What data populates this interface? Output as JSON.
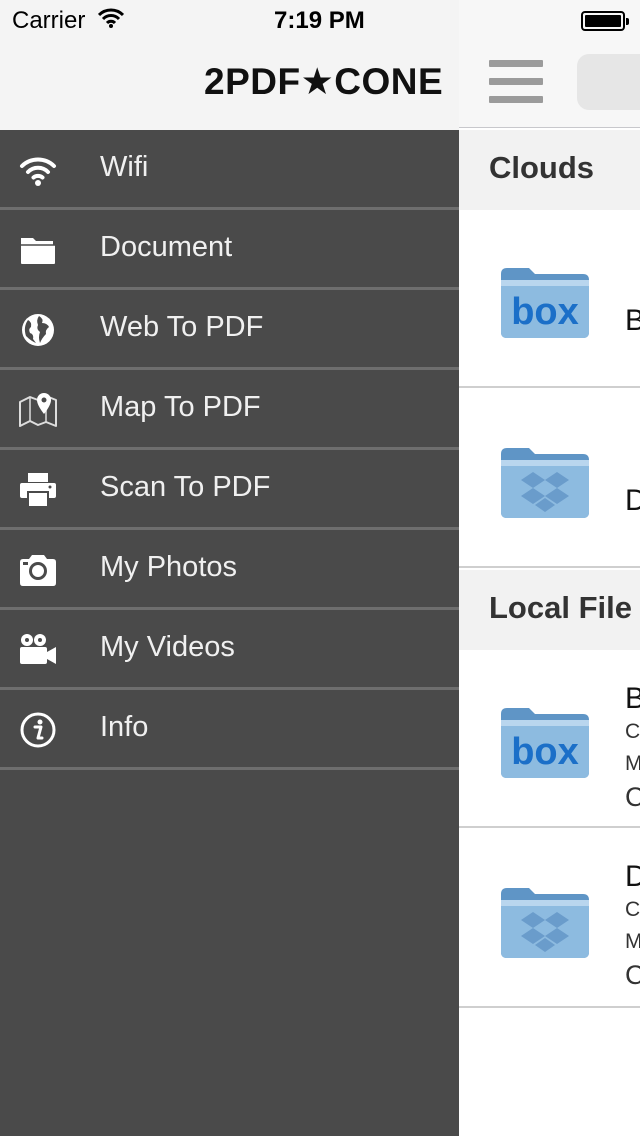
{
  "status_bar": {
    "carrier": "Carrier",
    "time": "7:19 PM"
  },
  "drawer": {
    "brand": "2PDF★CONE",
    "items": [
      {
        "label": "Wifi",
        "icon": "wifi-icon"
      },
      {
        "label": "Document",
        "icon": "folder-icon"
      },
      {
        "label": "Web To PDF",
        "icon": "globe-icon"
      },
      {
        "label": "Map To PDF",
        "icon": "map-pin-icon"
      },
      {
        "label": "Scan To PDF",
        "icon": "printer-icon"
      },
      {
        "label": "My Photos",
        "icon": "camera-icon"
      },
      {
        "label": "My Videos",
        "icon": "video-camera-icon"
      },
      {
        "label": "Info",
        "icon": "info-icon"
      }
    ]
  },
  "content": {
    "sections": [
      {
        "header": "Clouds",
        "rows": [
          {
            "icon": "box-folder-icon",
            "title": "B"
          },
          {
            "icon": "dropbox-folder-icon",
            "title": "D"
          }
        ]
      },
      {
        "header": "Local File",
        "rows": [
          {
            "icon": "box-folder-icon",
            "title": "B",
            "line1": "C",
            "line2": "M",
            "line3": "C"
          },
          {
            "icon": "dropbox-folder-icon",
            "title": "D",
            "line1": "C",
            "line2": "M",
            "line3": "C"
          }
        ]
      }
    ]
  },
  "colors": {
    "drawer_bg": "#4a4a4a",
    "drawer_divider": "#6e6e6e",
    "folder_blue": "#7fb0d8",
    "box_blue": "#1b6fc8"
  }
}
